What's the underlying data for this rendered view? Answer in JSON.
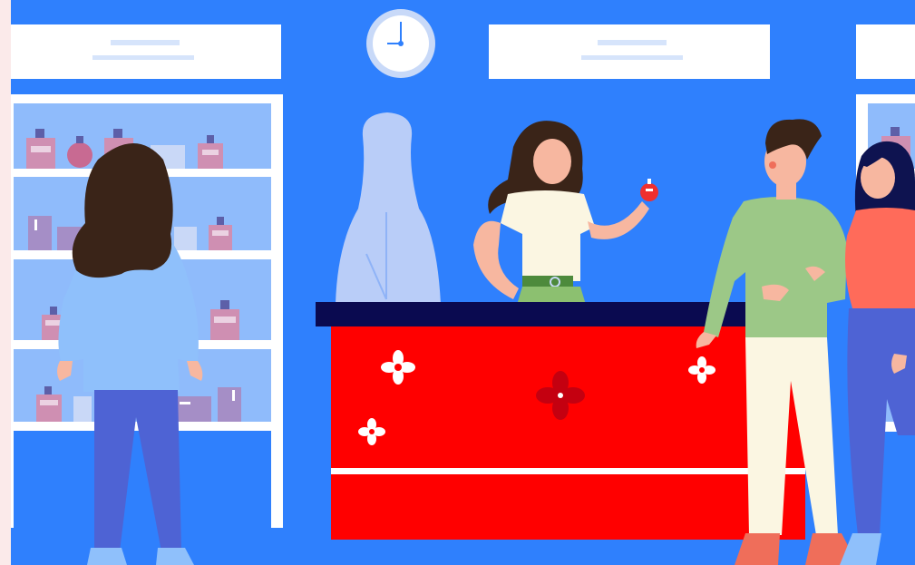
{
  "colors": {
    "wall": "#2f80fd",
    "sign": "#ffffff",
    "sign_line": "#d6e4fb",
    "shelf_back": "#8fbbfb",
    "shelf_board": "#ffffff",
    "counter_front": "#ff0000",
    "counter_top": "#0a0a50",
    "counter_stripe": "#ffffff",
    "flower_white": "#ffffff",
    "flower_dark": "#c40010",
    "mannequin": "#b9cdf8",
    "bottle_pink": "#cf8fb2",
    "bottle_purple": "#a58ec6",
    "hair": "#3a2418",
    "skin": "#f7b7a0",
    "clock_rim": "#c8d9f8",
    "clock_face": "#ffffff",
    "clock_hand": "#2f80fd"
  },
  "scene": {
    "setting": "perfume-shop",
    "people": [
      {
        "role": "customer-woman-back-view"
      },
      {
        "role": "seller-woman-holding-perfume"
      },
      {
        "role": "customer-man"
      },
      {
        "role": "customer-woman-arm-in-arm"
      }
    ]
  }
}
